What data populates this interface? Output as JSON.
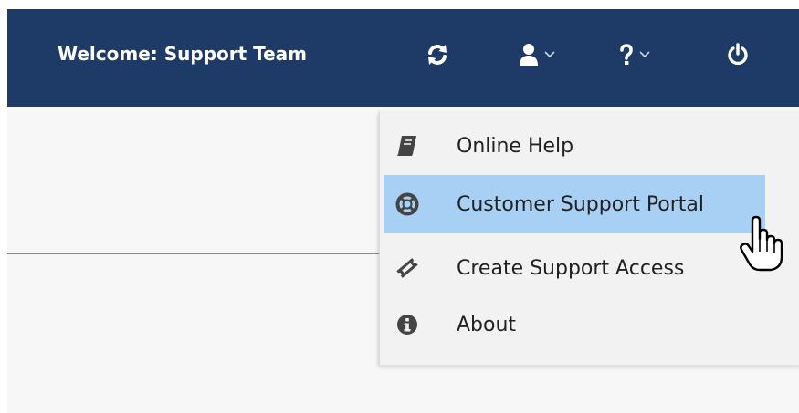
{
  "header": {
    "welcome_text": "Welcome: Support Team",
    "icons": {
      "refresh": "refresh-icon",
      "user": "user-icon",
      "help": "question-icon",
      "power": "power-icon"
    },
    "background_color": "#1e3a66"
  },
  "help_menu": {
    "items": [
      {
        "label": "Online Help",
        "icon": "book-icon"
      },
      {
        "label": "Customer Support Portal",
        "icon": "life-ring-icon",
        "highlighted": true
      },
      {
        "label": "Create Support Access",
        "icon": "ticket-icon"
      },
      {
        "label": "About",
        "icon": "info-icon"
      }
    ],
    "highlight_color": "#a8d0f5"
  }
}
